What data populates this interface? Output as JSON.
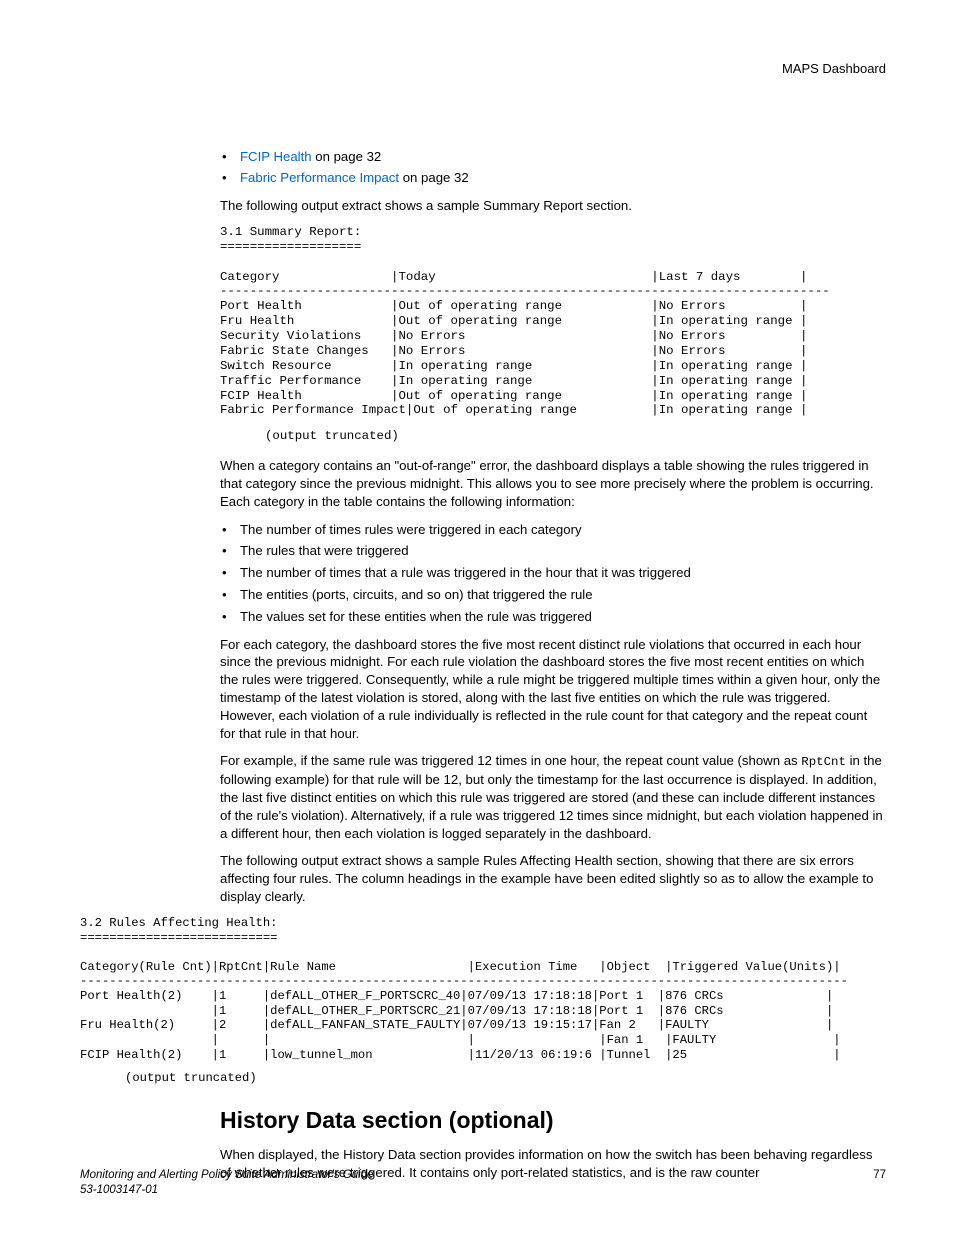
{
  "header": {
    "title": "MAPS Dashboard"
  },
  "links": {
    "items": [
      {
        "label": "FCIP Health",
        "suffix": " on page 32"
      },
      {
        "label": "Fabric Performance Impact",
        "suffix": " on page 32"
      }
    ]
  },
  "intro1": "The following output extract shows a sample Summary Report section.",
  "code1": "3.1 Summary Report:\n===================\n\nCategory               |Today                             |Last 7 days        |\n----------------------------------------------------------------------------------\nPort Health            |Out of operating range            |No Errors          |\nFru Health             |Out of operating range            |In operating range |\nSecurity Violations    |No Errors                         |No Errors          |\nFabric State Changes   |No Errors                         |No Errors          |\nSwitch Resource        |In operating range                |In operating range |\nTraffic Performance    |In operating range                |In operating range |\nFCIP Health            |Out of operating range            |In operating range |\nFabric Performance Impact|Out of operating range          |In operating range |",
  "trunc": "(output truncated)",
  "para1": "When a category contains an \"out-of-range\" error, the dashboard displays a table showing the rules triggered in that category since the previous midnight. This allows you to see more precisely where the problem is occurring. Each category in the table contains the following information:",
  "bullets": [
    "The number of times rules were triggered in each category",
    "The rules that were triggered",
    "The number of times that a rule was triggered in the hour that it was triggered",
    "The entities (ports, circuits, and so on) that triggered the rule",
    "The values set for these entities when the rule was triggered"
  ],
  "para2": "For each category, the dashboard stores the five most recent distinct rule violations that occurred in each hour since the previous midnight. For each rule violation the dashboard stores the five most recent entities on which the rules were triggered. Consequently, while a rule might be triggered multiple times within a given hour, only the timestamp of the latest violation is stored, along with the last five entities on which the rule was triggered. However, each violation of a rule individually is reflected in the rule count for that category and the repeat count for that rule in that hour.",
  "para3a": "For example, if the same rule was triggered 12 times in one hour, the repeat count value (shown as ",
  "para3_code": "RptCnt",
  "para3b": " in the following example) for that rule will be 12, but only the timestamp for the last occurrence is displayed. In addition, the last five distinct entities on which this rule was triggered are stored (and these can include different instances of the rule's violation). Alternatively, if a rule was triggered 12 times since midnight, but each violation happened in a different hour, then each violation is logged separately in the dashboard.",
  "para4": "The following output extract shows a sample Rules Affecting Health section, showing that there are six errors affecting four rules. The column headings in the example have been edited slightly so as to allow the example to display clearly.",
  "code2": "3.2 Rules Affecting Health:\n===========================\n\nCategory(Rule Cnt)|RptCnt|Rule Name                  |Execution Time   |Object  |Triggered Value(Units)|\n---------------------------------------------------------------------------------------------------------\nPort Health(2)    |1     |defALL_OTHER_F_PORTSCRC_40|07/09/13 17:18:18|Port 1  |876 CRCs              |\n                  |1     |defALL_OTHER_F_PORTSCRC_21|07/09/13 17:18:18|Port 1  |876 CRCs              |\nFru Health(2)     |2     |defALL_FANFAN_STATE_FAULTY|07/09/13 19:15:17|Fan 2   |FAULTY                |\n                  |      |                           |                 |Fan 1   |FAULTY                |\nFCIP Health(2)    |1     |low_tunnel_mon             |11/20/13 06:19:6 |Tunnel  |25                    |",
  "heading": "History Data section (optional)",
  "para5": "When displayed, the History Data section provides information on how the switch has been behaving regardless of whether rules were triggered. It contains only port-related statistics, and is the raw counter",
  "footer": {
    "left": "Monitoring and Alerting Policy Suite Administrator's Guide",
    "mid": "53-1003147-01",
    "page": "77"
  }
}
